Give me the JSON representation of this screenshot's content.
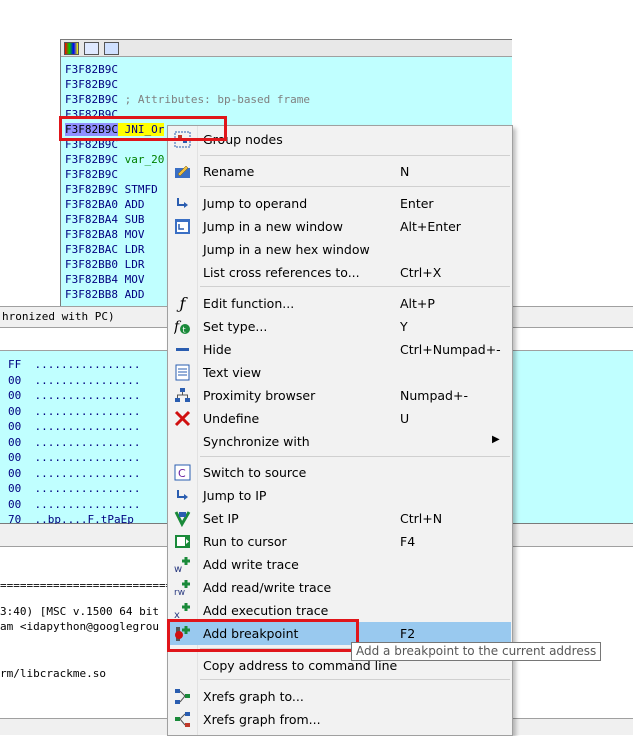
{
  "disasm": {
    "lines": [
      {
        "addr": "F3F82B9C",
        "rest": ""
      },
      {
        "addr": "F3F82B9C",
        "rest": ""
      },
      {
        "addr": "F3F82B9C",
        "rest": " ; Attributes: bp-based frame"
      },
      {
        "addr": "F3F82B9C",
        "rest": ""
      },
      {
        "addr": "F3F82B9C",
        "rest": " JNI_Or"
      },
      {
        "addr": "F3F82B9C",
        "rest": ""
      },
      {
        "addr": "F3F82B9C",
        "rest": " var_20"
      },
      {
        "addr": "F3F82B9C",
        "rest": ""
      },
      {
        "addr": "F3F82B9C",
        "rest": " STMFD"
      },
      {
        "addr": "F3F82BA0",
        "rest": " ADD"
      },
      {
        "addr": "F3F82BA4",
        "rest": " SUB"
      },
      {
        "addr": "F3F82BA8",
        "rest": " MOV"
      },
      {
        "addr": "F3F82BAC",
        "rest": " LDR"
      },
      {
        "addr": "F3F82BB0",
        "rest": " LDR"
      },
      {
        "addr": "F3F82BB4",
        "rest": " MOV"
      },
      {
        "addr": "F3F82BB8",
        "rest": " ADD"
      }
    ]
  },
  "syncbar": {
    "text": "hronized with PC)"
  },
  "hex": {
    "lines": [
      "FF  ................",
      "00  ................",
      "00  ................",
      "00  ................",
      "00  ................",
      "00  ................",
      "00  ................",
      "00  ................",
      "00  ................",
      "00  ................",
      "70  ..bp....F.tPaEp"
    ]
  },
  "output": {
    "line1": "================================",
    "line2": "3:40) [MSC v.1500 64 bit",
    "line3": "am <idapython@googlegrou",
    "line4": "",
    "line5": "rm/libcrackme.so"
  },
  "menu": {
    "items": [
      {
        "label": "Group nodes",
        "shortcut": "",
        "icon": "group-nodes-icon"
      },
      {
        "label": "Rename",
        "shortcut": "N",
        "icon": "rename-icon"
      },
      {
        "label": "Jump to operand",
        "shortcut": "Enter",
        "icon": "jump-arrow-icon"
      },
      {
        "label": "Jump in a new window",
        "shortcut": "Alt+Enter",
        "icon": "new-window-icon"
      },
      {
        "label": "Jump in a new hex window",
        "shortcut": "",
        "icon": ""
      },
      {
        "label": "List cross references to...",
        "shortcut": "Ctrl+X",
        "icon": ""
      },
      {
        "label": "Edit function...",
        "shortcut": "Alt+P",
        "icon": "function-icon"
      },
      {
        "label": "Set type...",
        "shortcut": "Y",
        "icon": "set-type-icon"
      },
      {
        "label": "Hide",
        "shortcut": "Ctrl+Numpad+-",
        "icon": "hide-icon"
      },
      {
        "label": "Text view",
        "shortcut": "",
        "icon": "text-view-icon"
      },
      {
        "label": "Proximity browser",
        "shortcut": "Numpad+-",
        "icon": "proximity-icon"
      },
      {
        "label": "Undefine",
        "shortcut": "U",
        "icon": "undefine-x-icon"
      },
      {
        "label": "Synchronize with",
        "shortcut": "",
        "icon": ""
      },
      {
        "label": "Switch to source",
        "shortcut": "",
        "icon": "switch-source-icon"
      },
      {
        "label": "Jump to IP",
        "shortcut": "",
        "icon": "jump-ip-icon"
      },
      {
        "label": "Set IP",
        "shortcut": "Ctrl+N",
        "icon": "set-ip-icon"
      },
      {
        "label": "Run to cursor",
        "shortcut": "F4",
        "icon": "run-to-cursor-icon"
      },
      {
        "label": "Add write trace",
        "shortcut": "",
        "icon": "write-trace-icon"
      },
      {
        "label": "Add read/write trace",
        "shortcut": "",
        "icon": "rw-trace-icon"
      },
      {
        "label": "Add execution trace",
        "shortcut": "",
        "icon": "exec-trace-icon"
      },
      {
        "label": "Add breakpoint",
        "shortcut": "F2",
        "icon": "breakpoint-icon"
      },
      {
        "label": "Copy address to command line",
        "shortcut": "",
        "icon": ""
      },
      {
        "label": "Xrefs graph to...",
        "shortcut": "",
        "icon": "xrefs-to-icon"
      },
      {
        "label": "Xrefs graph from...",
        "shortcut": "",
        "icon": "xrefs-from-icon"
      }
    ]
  },
  "tooltip": {
    "text": "Add a breakpoint to the current address"
  },
  "colors": {
    "highlight": "#99c9ef",
    "redbox": "#e0151a",
    "disasm_bg": "#c0ffff"
  }
}
